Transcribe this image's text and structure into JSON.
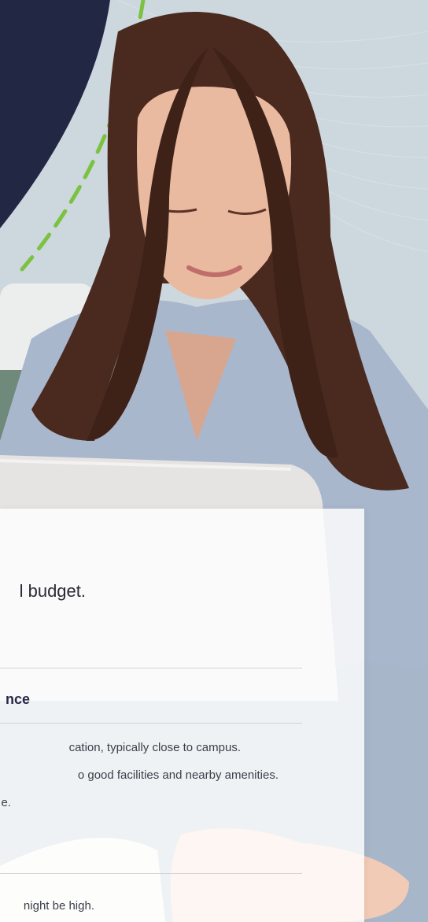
{
  "hero": {
    "colors": {
      "navy": "#222744",
      "green_dash": "#7cc242",
      "wall": "#cdd7de",
      "hair": "#4a2a1e",
      "skin": "#e9b9a0",
      "shirt": "#a9b7cc",
      "laptop": "#e6e4e2"
    },
    "image": "woman-with-laptop-photo"
  },
  "card": {
    "headline_tail": "l budget.",
    "section_title_tail": "nce",
    "list": [
      "cation, typically close to campus.",
      "o good facilities and nearby amenities.",
      "e."
    ],
    "list_bottom": "night be high."
  }
}
